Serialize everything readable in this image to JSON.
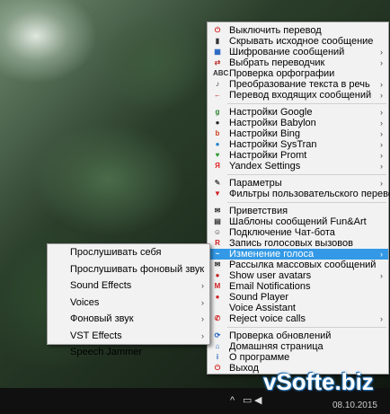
{
  "menu": {
    "groups": [
      [
        {
          "label": "Выключить перевод",
          "icon": "power-off-icon",
          "glyph": "⏻",
          "color": "#d02020",
          "sub": false
        },
        {
          "label": "Скрывать исходное сообщение",
          "icon": "hide-message-icon",
          "glyph": "▮",
          "color": "#333",
          "sub": false
        },
        {
          "label": "Шифрование сообщений",
          "icon": "encrypt-icon",
          "glyph": "▦",
          "color": "#2060c0",
          "sub": true
        },
        {
          "label": "Выбрать переводчик",
          "icon": "translator-icon",
          "glyph": "⇄",
          "color": "#c03030",
          "sub": true
        },
        {
          "label": "Проверка орфографии",
          "icon": "spellcheck-icon",
          "glyph": "ABC",
          "color": "#333",
          "sub": false
        },
        {
          "label": "Преобразование текста в речь",
          "icon": "music-note-icon",
          "glyph": "♪",
          "color": "#333",
          "sub": true
        },
        {
          "label": "Перевод входящих сообщений",
          "icon": "incoming-arrow-icon",
          "glyph": "←",
          "color": "#c02020",
          "sub": true
        }
      ],
      [
        {
          "label": "Настройки Google",
          "icon": "google-icon",
          "glyph": "g",
          "color": "#2a7d2a",
          "sub": true
        },
        {
          "label": "Настройки Babylon",
          "icon": "babylon-icon",
          "glyph": "●",
          "color": "#222",
          "sub": true
        },
        {
          "label": "Настройки Bing",
          "icon": "bing-icon",
          "glyph": "b",
          "color": "#d04020",
          "sub": true
        },
        {
          "label": "Настройки SysTran",
          "icon": "systran-icon",
          "glyph": "●",
          "color": "#2080d0",
          "sub": true
        },
        {
          "label": "Настройки Promt",
          "icon": "promt-icon",
          "glyph": "♥",
          "color": "#2a9a2a",
          "sub": true
        },
        {
          "label": "Yandex Settings",
          "icon": "yandex-icon",
          "glyph": "Я",
          "color": "#e02020",
          "sub": true
        }
      ],
      [
        {
          "label": "Параметры",
          "icon": "wrench-icon",
          "glyph": "✎",
          "color": "#555",
          "sub": true
        },
        {
          "label": "Фильтры пользовательского перевода",
          "icon": "filter-icon",
          "glyph": "▼",
          "color": "#d02020",
          "sub": false
        }
      ],
      [
        {
          "label": "Приветствия",
          "icon": "envelope-icon",
          "glyph": "✉",
          "color": "#333",
          "sub": false
        },
        {
          "label": "Шаблоны сообщений Fun&Art",
          "icon": "template-icon",
          "glyph": "▤",
          "color": "#333",
          "sub": false
        },
        {
          "label": "Подключение Чат-бота",
          "icon": "chatbot-icon",
          "glyph": "☺",
          "color": "#333",
          "sub": false
        },
        {
          "label": "Запись голосовых вызовов",
          "icon": "record-icon",
          "glyph": "R",
          "color": "#d02020",
          "sub": false
        },
        {
          "label": "Изменение голоса",
          "icon": "voice-change-icon",
          "glyph": "~",
          "color": "#fff",
          "sub": true,
          "highlight": true
        },
        {
          "label": "Рассылка массовых сообщений",
          "icon": "broadcast-icon",
          "glyph": "✉",
          "color": "#333",
          "sub": false
        },
        {
          "label": "Show user avatars",
          "icon": "avatar-icon",
          "glyph": "●",
          "color": "#c02020",
          "sub": true
        },
        {
          "label": "Email Notifications",
          "icon": "email-icon",
          "glyph": "M",
          "color": "#d02020",
          "sub": false
        },
        {
          "label": "Sound Player",
          "icon": "sound-player-icon",
          "glyph": "●",
          "color": "#d02020",
          "sub": false
        },
        {
          "label": "Voice Assistant",
          "icon": "",
          "glyph": "",
          "color": "#333",
          "sub": false
        },
        {
          "label": "Reject voice calls",
          "icon": "reject-call-icon",
          "glyph": "✆",
          "color": "#d02020",
          "sub": true
        }
      ],
      [
        {
          "label": "Проверка обновлений",
          "icon": "update-icon",
          "glyph": "⟳",
          "color": "#2060c0",
          "sub": false
        },
        {
          "label": "Домашняя страница",
          "icon": "home-icon",
          "glyph": "⌂",
          "color": "#2060c0",
          "sub": false
        },
        {
          "label": "О программе",
          "icon": "info-icon",
          "glyph": "i",
          "color": "#2060c0",
          "sub": false
        },
        {
          "label": "Выход",
          "icon": "exit-icon",
          "glyph": "⏻",
          "color": "#d02020",
          "sub": false
        }
      ]
    ]
  },
  "submenu": {
    "items": [
      {
        "label": "Прослушивать себя",
        "sub": false
      },
      {
        "label": "Прослушивать фоновый звук",
        "sub": false
      },
      {
        "label": "Sound Effects",
        "sub": true
      },
      {
        "label": "Voices",
        "sub": true
      },
      {
        "label": "Фоновый звук",
        "sub": true
      },
      {
        "label": "VST Effects",
        "sub": true
      },
      {
        "label": "Speech Jammer",
        "sub": false
      }
    ]
  },
  "taskbar": {
    "clock_text": "08.10.2015"
  },
  "watermark": {
    "text": "vSofte.biz"
  }
}
